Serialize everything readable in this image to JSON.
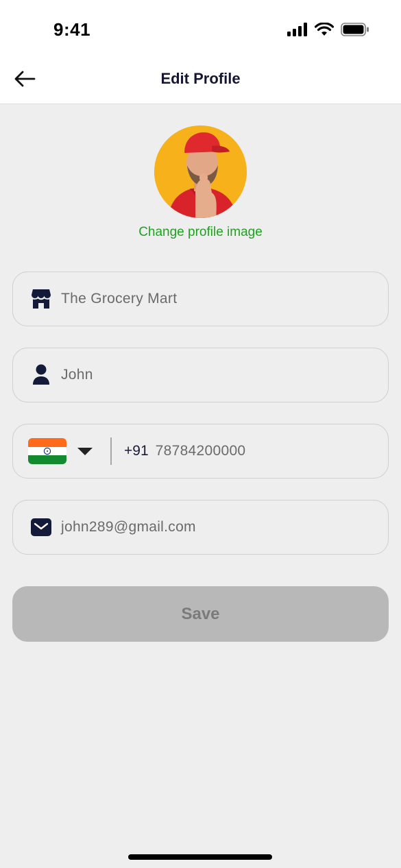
{
  "status_bar": {
    "time": "9:41",
    "signal_icon": "cellular-signal-icon",
    "wifi_icon": "wifi-icon",
    "battery_icon": "battery-icon"
  },
  "header": {
    "title": "Edit Profile",
    "back_icon": "back-arrow-icon"
  },
  "profile": {
    "avatar": "profile-avatar",
    "change_image_label": "Change profile image"
  },
  "form": {
    "store_name": {
      "value": "The Grocery Mart",
      "icon": "store-icon"
    },
    "name": {
      "value": "John",
      "icon": "user-icon"
    },
    "phone": {
      "country_flag": "india-flag-icon",
      "dial_code": "+91",
      "value": "78784200000",
      "dropdown_icon": "caret-down-icon"
    },
    "email": {
      "value": "john289@gmail.com",
      "icon": "mail-icon"
    }
  },
  "actions": {
    "save_label": "Save"
  },
  "colors": {
    "accent_green": "#1ea21e",
    "title": "#161633",
    "disabled_button": "#b8b8b8",
    "background": "#eeeeee"
  }
}
